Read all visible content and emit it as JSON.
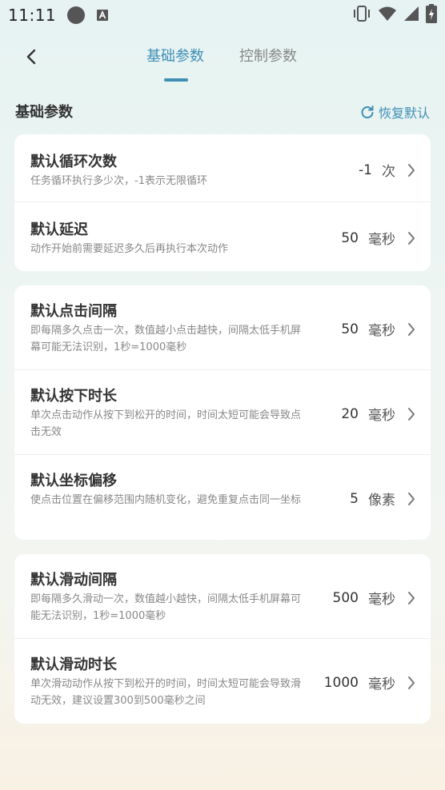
{
  "status_bar": {
    "time": "11:11"
  },
  "nav": {
    "tab_basic": "基础参数",
    "tab_control": "控制参数"
  },
  "section": {
    "title": "基础参数",
    "restore_label": "恢复默认"
  },
  "cards": [
    {
      "items": [
        {
          "title": "默认循环次数",
          "desc": "任务循环执行多少次，-1表示无限循环",
          "value": "-1",
          "unit": "次"
        },
        {
          "title": "默认延迟",
          "desc": "动作开始前需要延迟多久后再执行本次动作",
          "value": "50",
          "unit": "毫秒"
        }
      ]
    },
    {
      "items": [
        {
          "title": "默认点击间隔",
          "desc": "即每隔多久点击一次，数值越小点击越快，间隔太低手机屏幕可能无法识别，1秒=1000毫秒",
          "value": "50",
          "unit": "毫秒"
        },
        {
          "title": "默认按下时长",
          "desc": "单次点击动作从按下到松开的时间，时间太短可能会导致点击无效",
          "value": "20",
          "unit": "毫秒"
        },
        {
          "title": "默认坐标偏移",
          "desc": "使点击位置在偏移范围内随机变化，避免重复点击同一坐标",
          "value": "5",
          "unit": "像素"
        }
      ]
    },
    {
      "items": [
        {
          "title": "默认滑动间隔",
          "desc": "即每隔多久滑动一次，数值越小越快，间隔太低手机屏幕可能无法识别，1秒=1000毫秒",
          "value": "500",
          "unit": "毫秒"
        },
        {
          "title": "默认滑动时长",
          "desc": "单次滑动动作从按下到松开的时间，时间太短可能会导致滑动无效，建议设置300到500毫秒之间",
          "value": "1000",
          "unit": "毫秒"
        }
      ]
    }
  ],
  "colors": {
    "accent": "#3f8fb5",
    "card": "#ffffff"
  },
  "icons": [
    "back-arrow-icon",
    "refresh-icon",
    "chevron-right-icon",
    "vibrate-icon",
    "wifi-icon",
    "signal-icon",
    "battery-icon",
    "notification-dot-icon",
    "app-a-icon"
  ]
}
